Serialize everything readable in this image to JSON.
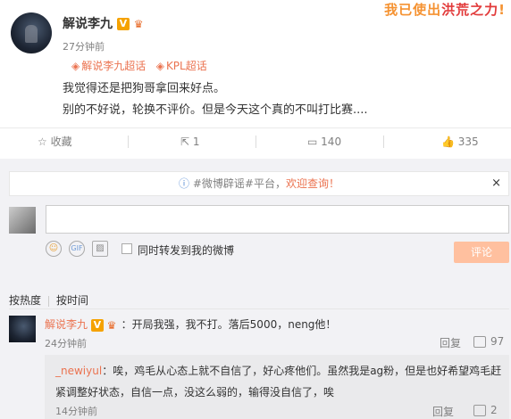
{
  "banner": {
    "part1": "我已使出",
    "part2": "洪荒之力",
    "part3": "!"
  },
  "post": {
    "username": "解说李九",
    "v_badge": "V",
    "time": "27分钟前",
    "supertopics": [
      "解说李九超话",
      "KPL超话"
    ],
    "lines": [
      "我觉得还是把狗哥拿回来好点。",
      "别的不好说，轮换不评价。但是今天这个真的不叫打比赛...."
    ]
  },
  "actions": {
    "favorite": "收藏",
    "repost": "1",
    "comments": "140",
    "likes": "335"
  },
  "notice": {
    "prefix": "#微博辟谣#平台，",
    "link": "欢迎查询！",
    "close": "×"
  },
  "composer": {
    "input_value": "",
    "repost_label": "同时转发到我的微博",
    "submit": "评论"
  },
  "sort": {
    "hot": "按热度",
    "time": "按时间"
  },
  "comments": [
    {
      "username": "解说李九",
      "text": "：开局我强，我不打。落后5000，neng他！",
      "time": "24分钟前",
      "reply": "回复",
      "likes": "97",
      "subreply": {
        "username": "_newiyul",
        "text": "：唉，鸡毛从心态上就不自信了，好心疼他们。虽然我是ag粉，但是也好希望鸡毛赶紧调整好状态，自信一点，没这么弱的，输得没自信了，唉",
        "time": "14分钟前",
        "reply": "回复",
        "likes": "2"
      }
    }
  ],
  "icons": {
    "favorite": "star-icon",
    "repost": "repost-icon",
    "comment": "comment-icon",
    "like": "thumb-up-icon",
    "emoji": "smiley-icon",
    "gif": "gif-icon",
    "image": "image-icon",
    "info": "info-icon"
  },
  "colors": {
    "accent": "#eb7350",
    "vip": "#f5a200",
    "panel_bg": "#f2f2f5",
    "submit_disabled": "#ffc09f"
  }
}
